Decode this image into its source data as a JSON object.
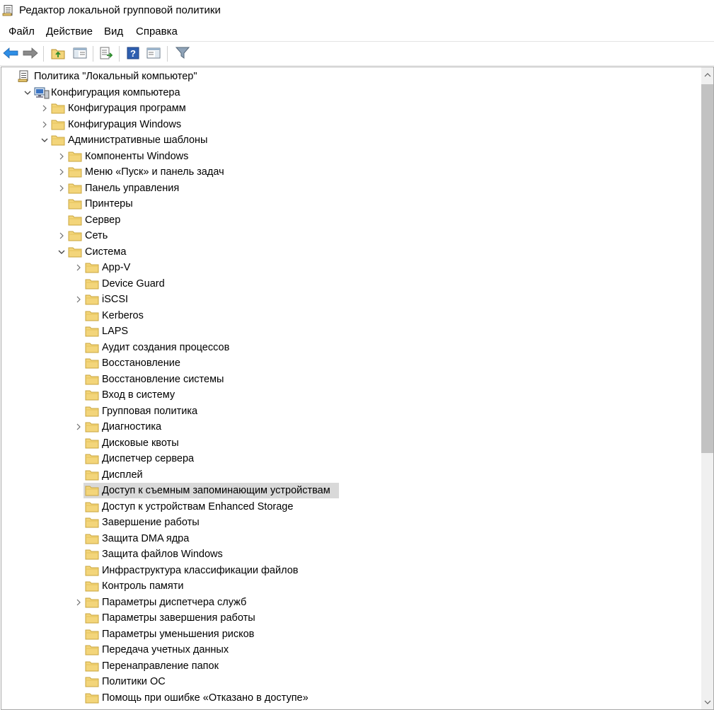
{
  "window": {
    "title": "Редактор локальной групповой политики"
  },
  "menu": [
    "Файл",
    "Действие",
    "Вид",
    "Справка"
  ],
  "toolbar": {
    "buttons": [
      "back-icon",
      "forward-icon",
      "up-folder-icon",
      "show-hide-tree-icon",
      "export-list-icon",
      "help-icon",
      "show-action-pane-icon",
      "filter-icon"
    ]
  },
  "colors": {
    "selection": "#d9d9d9",
    "folder": "#f3d57a",
    "back_arrow": "#2e8ee6",
    "forward_arrow": "#7c7c7c"
  },
  "tree": [
    {
      "label": "Политика \"Локальный компьютер\"",
      "level": 0,
      "expander": "none",
      "icon": "policy-document-icon"
    },
    {
      "label": "Конфигурация компьютера",
      "level": 1,
      "expander": "expanded",
      "icon": "computer-icon"
    },
    {
      "label": "Конфигурация программ",
      "level": 2,
      "expander": "collapsed",
      "icon": "folder-icon"
    },
    {
      "label": "Конфигурация Windows",
      "level": 2,
      "expander": "collapsed",
      "icon": "folder-icon"
    },
    {
      "label": "Административные шаблоны",
      "level": 2,
      "expander": "expanded",
      "icon": "folder-icon"
    },
    {
      "label": "Компоненты Windows",
      "level": 3,
      "expander": "collapsed",
      "icon": "folder-icon"
    },
    {
      "label": "Меню «Пуск» и панель задач",
      "level": 3,
      "expander": "collapsed",
      "icon": "folder-icon"
    },
    {
      "label": "Панель управления",
      "level": 3,
      "expander": "collapsed",
      "icon": "folder-icon"
    },
    {
      "label": "Принтеры",
      "level": 3,
      "expander": "none",
      "icon": "folder-icon"
    },
    {
      "label": "Сервер",
      "level": 3,
      "expander": "none",
      "icon": "folder-icon"
    },
    {
      "label": "Сеть",
      "level": 3,
      "expander": "collapsed",
      "icon": "folder-icon"
    },
    {
      "label": "Система",
      "level": 3,
      "expander": "expanded",
      "icon": "folder-icon"
    },
    {
      "label": "App-V",
      "level": 4,
      "expander": "collapsed",
      "icon": "folder-icon"
    },
    {
      "label": "Device Guard",
      "level": 4,
      "expander": "none",
      "icon": "folder-icon"
    },
    {
      "label": "iSCSI",
      "level": 4,
      "expander": "collapsed",
      "icon": "folder-icon"
    },
    {
      "label": "Kerberos",
      "level": 4,
      "expander": "none",
      "icon": "folder-icon"
    },
    {
      "label": "LAPS",
      "level": 4,
      "expander": "none",
      "icon": "folder-icon"
    },
    {
      "label": "Аудит создания процессов",
      "level": 4,
      "expander": "none",
      "icon": "folder-icon"
    },
    {
      "label": "Восстановление",
      "level": 4,
      "expander": "none",
      "icon": "folder-icon"
    },
    {
      "label": "Восстановление системы",
      "level": 4,
      "expander": "none",
      "icon": "folder-icon"
    },
    {
      "label": "Вход в систему",
      "level": 4,
      "expander": "none",
      "icon": "folder-icon"
    },
    {
      "label": "Групповая политика",
      "level": 4,
      "expander": "none",
      "icon": "folder-icon"
    },
    {
      "label": "Диагностика",
      "level": 4,
      "expander": "collapsed",
      "icon": "folder-icon"
    },
    {
      "label": "Дисковые квоты",
      "level": 4,
      "expander": "none",
      "icon": "folder-icon"
    },
    {
      "label": "Диспетчер сервера",
      "level": 4,
      "expander": "none",
      "icon": "folder-icon"
    },
    {
      "label": "Дисплей",
      "level": 4,
      "expander": "none",
      "icon": "folder-icon"
    },
    {
      "label": "Доступ к съемным запоминающим устройствам",
      "level": 4,
      "expander": "none",
      "icon": "folder-icon",
      "selected": true
    },
    {
      "label": "Доступ к устройствам Enhanced Storage",
      "level": 4,
      "expander": "none",
      "icon": "folder-icon"
    },
    {
      "label": "Завершение работы",
      "level": 4,
      "expander": "none",
      "icon": "folder-icon"
    },
    {
      "label": "Защита DMA ядра",
      "level": 4,
      "expander": "none",
      "icon": "folder-icon"
    },
    {
      "label": "Защита файлов Windows",
      "level": 4,
      "expander": "none",
      "icon": "folder-icon"
    },
    {
      "label": "Инфраструктура классификации файлов",
      "level": 4,
      "expander": "none",
      "icon": "folder-icon"
    },
    {
      "label": "Контроль памяти",
      "level": 4,
      "expander": "none",
      "icon": "folder-icon"
    },
    {
      "label": "Параметры диспетчера служб",
      "level": 4,
      "expander": "collapsed",
      "icon": "folder-icon"
    },
    {
      "label": "Параметры завершения работы",
      "level": 4,
      "expander": "none",
      "icon": "folder-icon"
    },
    {
      "label": "Параметры уменьшения рисков",
      "level": 4,
      "expander": "none",
      "icon": "folder-icon"
    },
    {
      "label": "Передача учетных данных",
      "level": 4,
      "expander": "none",
      "icon": "folder-icon"
    },
    {
      "label": "Перенаправление папок",
      "level": 4,
      "expander": "none",
      "icon": "folder-icon"
    },
    {
      "label": "Политики ОС",
      "level": 4,
      "expander": "none",
      "icon": "folder-icon"
    },
    {
      "label": "Помощь при ошибке «Отказано в доступе»",
      "level": 4,
      "expander": "none",
      "icon": "folder-icon"
    }
  ]
}
